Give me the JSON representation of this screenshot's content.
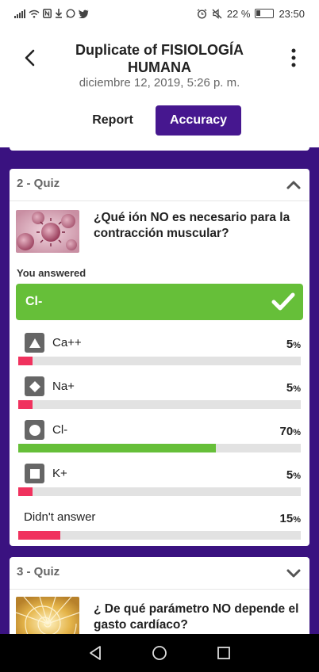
{
  "status_bar": {
    "battery_percent": "22 %",
    "time": "23:50"
  },
  "header": {
    "title": "Duplicate of FISIOLOGÍA HUMANA",
    "date": "diciembre 12, 2019, 5:26 p. m.",
    "tabs": [
      {
        "label": "Report",
        "active": false
      },
      {
        "label": "Accuracy",
        "active": true
      }
    ],
    "accent_color": "#46178f"
  },
  "questions": [
    {
      "heading": "2 - Quiz",
      "expanded": true,
      "question": "¿Qué ión NO es necesario para la contracción muscular?",
      "you_answered_label": "You answered",
      "your_answer": "Cl-",
      "answer_correct": true,
      "options": [
        {
          "icon": "triangle-icon",
          "label": "Ca++",
          "percent": 5,
          "percent_label": "5",
          "correct": false
        },
        {
          "icon": "diamond-icon",
          "label": "Na+",
          "percent": 5,
          "percent_label": "5",
          "correct": false
        },
        {
          "icon": "circle-icon",
          "label": "Cl-",
          "percent": 70,
          "percent_label": "70",
          "correct": true
        },
        {
          "icon": "square-icon",
          "label": "K+",
          "percent": 5,
          "percent_label": "5",
          "correct": false
        }
      ],
      "no_answer": {
        "label": "Didn't answer",
        "percent": 15,
        "percent_label": "15"
      },
      "percent_sign": "%"
    },
    {
      "heading": "3 - Quiz",
      "expanded": false,
      "question": "¿ De qué parámetro NO depende el gasto cardíaco?"
    }
  ],
  "colors": {
    "correct_green": "#66bf39",
    "incorrect_red": "#f0325e",
    "track_gray": "#e2e2e2",
    "background_purple": "#3a1280"
  }
}
